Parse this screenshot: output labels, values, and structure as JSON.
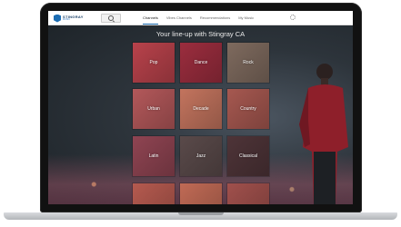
{
  "header": {
    "brand": "STINGRAY",
    "brand_sub": "MUSIC",
    "nav": [
      "Channels",
      "Vibes Channels",
      "Recommendations",
      "My Music"
    ]
  },
  "main": {
    "title": "Your line-up with Stingray CA",
    "tiles": [
      {
        "label": "Pop",
        "color": "#b8424b"
      },
      {
        "label": "Dance",
        "color": "#9b2d3e"
      },
      {
        "label": "Rock",
        "color": "#7e6a5e"
      },
      {
        "label": "Urban",
        "color": "#b3585a"
      },
      {
        "label": "Decade",
        "color": "#c3745e"
      },
      {
        "label": "Country",
        "color": "#a65850"
      },
      {
        "label": "Latin",
        "color": "#8f4452"
      },
      {
        "label": "Jazz",
        "color": "#5a4a4a"
      },
      {
        "label": "Classical",
        "color": "#4e3438"
      },
      {
        "label": "",
        "color": "#b55a4f"
      },
      {
        "label": "",
        "color": "#c06a55"
      },
      {
        "label": "",
        "color": "#a0504c"
      }
    ]
  }
}
